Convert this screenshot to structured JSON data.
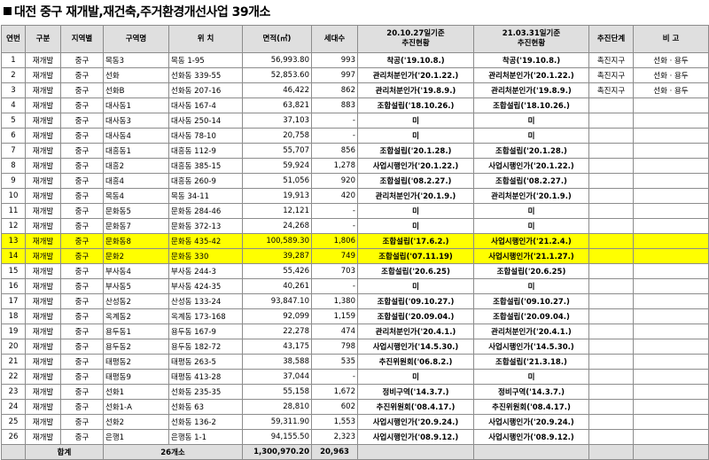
{
  "title": "대전 중구 재개발,재건축,주거환경개선사업 39개소",
  "headers": [
    "연번",
    "구분",
    "지역별",
    "구역명",
    "위 치",
    "면적(㎡)",
    "세대수",
    "20.10.27일기준\n추진현황",
    "21.03.31일기준\n추진현황",
    "추진단계",
    "비 고"
  ],
  "rows": [
    [
      "1",
      "재개발",
      "중구",
      "목동3",
      "목동 1-95",
      "56,993.80",
      "993",
      "착공('19.10.8.)",
      "착공('19.10.8.)",
      "촉진지구",
      "선화 · 용두"
    ],
    [
      "2",
      "재개발",
      "중구",
      "선화",
      "선화동 339-55",
      "52,853.60",
      "997",
      "관리처분인가('20.1.22.)",
      "관리처분인가('20.1.22.)",
      "촉진지구",
      "선화 · 용두"
    ],
    [
      "3",
      "재개발",
      "중구",
      "선화B",
      "선화동 207-16",
      "46,422",
      "862",
      "관리처분인가('19.8.9.)",
      "관리처분인가('19.8.9.)",
      "촉진지구",
      "선화 · 용두"
    ],
    [
      "4",
      "재개발",
      "중구",
      "대사동1",
      "대사동 167-4",
      "63,821",
      "883",
      "조합설립('18.10.26.)",
      "조합설립('18.10.26.)",
      "",
      ""
    ],
    [
      "5",
      "재개발",
      "중구",
      "대사동3",
      "대사동 250-14",
      "37,103",
      "-",
      "미",
      "미",
      "",
      ""
    ],
    [
      "6",
      "재개발",
      "중구",
      "대사동4",
      "대사동 78-10",
      "20,758",
      "-",
      "미",
      "미",
      "",
      ""
    ],
    [
      "7",
      "재개발",
      "중구",
      "대흥동1",
      "대흥동 112-9",
      "55,707",
      "856",
      "조합설립('20.1.28.)",
      "조합설립('20.1.28.)",
      "",
      ""
    ],
    [
      "8",
      "재개발",
      "중구",
      "대흥2",
      "대흥동 385-15",
      "59,924",
      "1,278",
      "사업시행인가('20.1.22.)",
      "사업시행인가('20.1.22.)",
      "",
      ""
    ],
    [
      "9",
      "재개발",
      "중구",
      "대흥4",
      "대흥동 260-9",
      "51,056",
      "920",
      "조합설립('08.2.27.)",
      "조합설립('08.2.27.)",
      "",
      ""
    ],
    [
      "10",
      "재개발",
      "중구",
      "목동4",
      "목동 34-11",
      "19,913",
      "420",
      "관리처분인가('20.1.9.)",
      "관리처분인가('20.1.9.)",
      "",
      ""
    ],
    [
      "11",
      "재개발",
      "중구",
      "문화동5",
      "문화동 284-46",
      "12,121",
      "-",
      "미",
      "미",
      "",
      ""
    ],
    [
      "12",
      "재개발",
      "중구",
      "문화동7",
      "문화동 372-13",
      "24,268",
      "-",
      "미",
      "미",
      "",
      ""
    ],
    [
      "13",
      "재개발",
      "중구",
      "문화동8",
      "문화동 435-42",
      "100,589.30",
      "1,806",
      "조합설립('17.6.2.)",
      "사업시행인가('21.2.4.)",
      "",
      ""
    ],
    [
      "14",
      "재개발",
      "중구",
      "문화2",
      "문화동 330",
      "39,287",
      "749",
      "조합설립('07.11.19)",
      "사업시행인가('21.1.27.)",
      "",
      ""
    ],
    [
      "15",
      "재개발",
      "중구",
      "부사동4",
      "부사동 244-3",
      "55,426",
      "703",
      "조합설립('20.6.25)",
      "조합설립('20.6.25)",
      "",
      ""
    ],
    [
      "16",
      "재개발",
      "중구",
      "부사동5",
      "부사동 424-35",
      "40,261",
      "-",
      "미",
      "미",
      "",
      ""
    ],
    [
      "17",
      "재개발",
      "중구",
      "산성동2",
      "산성동 133-24",
      "93,847.10",
      "1,380",
      "조합설립('09.10.27.)",
      "조합설립('09.10.27.)",
      "",
      ""
    ],
    [
      "18",
      "재개발",
      "중구",
      "옥계동2",
      "옥계동 173-168",
      "92,099",
      "1,159",
      "조합설립('20.09.04.)",
      "조합설립('20.09.04.)",
      "",
      ""
    ],
    [
      "19",
      "재개발",
      "중구",
      "용두동1",
      "용두동 167-9",
      "22,278",
      "474",
      "관리처분인가('20.4.1.)",
      "관리처분인가('20.4.1.)",
      "",
      ""
    ],
    [
      "20",
      "재개발",
      "중구",
      "용두동2",
      "용두동 182-72",
      "43,175",
      "798",
      "사업시행인가('14.5.30.)",
      "사업시행인가('14.5.30.)",
      "",
      ""
    ],
    [
      "21",
      "재개발",
      "중구",
      "태평동2",
      "태평동 263-5",
      "38,588",
      "535",
      "추진위원회('06.8.2.)",
      "조합설립('21.3.18.)",
      "",
      ""
    ],
    [
      "22",
      "재개발",
      "중구",
      "태평동9",
      "태평동 413-28",
      "37,044",
      "-",
      "미",
      "미",
      "",
      ""
    ],
    [
      "23",
      "재개발",
      "중구",
      "선화1",
      "선화동 235-35",
      "55,158",
      "1,672",
      "정비구역('14.3.7.)",
      "정비구역('14.3.7.)",
      "",
      ""
    ],
    [
      "24",
      "재개발",
      "중구",
      "선화1-A",
      "선화동 63",
      "28,810",
      "602",
      "추진위원회('08.4.17.)",
      "추진위원회('08.4.17.)",
      "",
      ""
    ],
    [
      "25",
      "재개발",
      "중구",
      "선화2",
      "선화동 136-2",
      "59,311.90",
      "1,553",
      "사업시행인가('20.9.24.)",
      "사업시행인가('20.9.24.)",
      "",
      ""
    ],
    [
      "26",
      "재개발",
      "중구",
      "은행1",
      "은행동 1-1",
      "94,155.50",
      "2,323",
      "사업시행인가('08.9.12.)",
      "사업시행인가('08.9.12.)",
      "",
      ""
    ]
  ],
  "total": {
    "label": "합계",
    "count": "26개소",
    "area": "1,300,970.20",
    "units": "20,963"
  }
}
